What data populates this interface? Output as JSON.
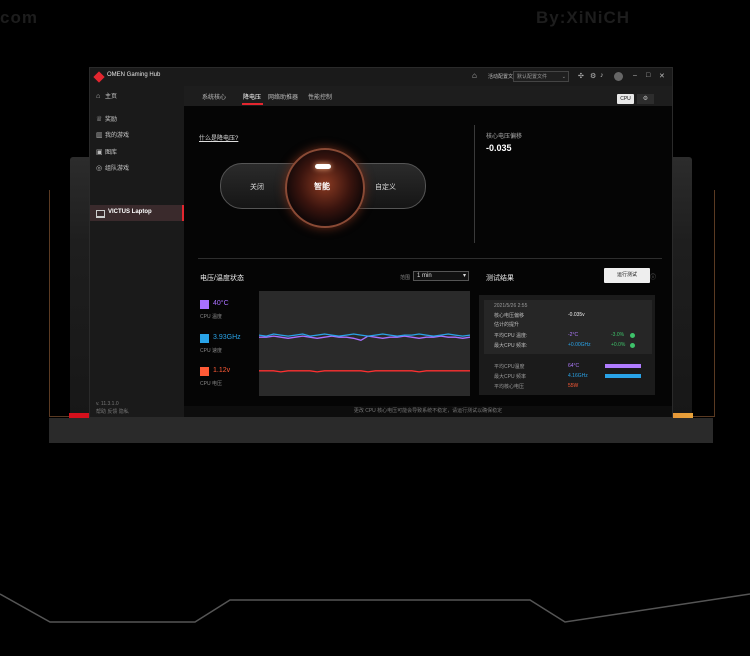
{
  "watermark": {
    "left": "com",
    "right": "By:XiNiCH"
  },
  "window": {
    "title": "OMEN Gaming Hub",
    "profile_label": "活动配置文件",
    "profile_value": "默认配置文件"
  },
  "sidebar": {
    "items": [
      {
        "icon": "home-icon",
        "glyph": "⌂",
        "label": "主页"
      },
      {
        "icon": "trophy-icon",
        "glyph": "♕",
        "label": "奖励"
      },
      {
        "icon": "library-icon",
        "glyph": "▥",
        "label": "我的游戏"
      },
      {
        "icon": "gallery-icon",
        "glyph": "▣",
        "label": "图库"
      },
      {
        "icon": "gamepad-icon",
        "glyph": "◎",
        "label": "组队游戏"
      }
    ],
    "device": "VICTUS Laptop",
    "version": "v. 11.3.1.0",
    "footer": "帮助  反馈  隐私"
  },
  "tabs": [
    {
      "label": "系统核心",
      "active": false
    },
    {
      "label": "降电压",
      "active": true
    },
    {
      "label": "网络助推器",
      "active": false
    },
    {
      "label": "性能控制",
      "active": false
    }
  ],
  "toggle": {
    "cpu": "CPU",
    "settings_glyph": "⚙"
  },
  "undervolt": {
    "what_link": "什么是降电压?",
    "mode_off": "关闭",
    "mode_smart": "智能",
    "mode_custom": "自定义",
    "offset_label": "核心电压偏移",
    "offset_value": "-0.035"
  },
  "voltage_panel": {
    "title": "电压/温度状态",
    "range_label": "范围",
    "range_value": "1 min",
    "stats": [
      {
        "value": "40°C",
        "label": "CPU 温度",
        "color": "#a970ff"
      },
      {
        "value": "3.93GHz",
        "label": "CPU 速度",
        "color": "#29a3e8"
      },
      {
        "value": "1.12v",
        "label": "CPU 电压",
        "color": "#ff5a36"
      }
    ]
  },
  "chart_data": {
    "type": "line",
    "title": "",
    "series": [
      {
        "color": "#a970ff",
        "values": [
          0.44,
          0.44,
          0.43,
          0.44,
          0.45,
          0.44,
          0.43,
          0.44,
          0.45,
          0.44,
          0.43,
          0.44,
          0.44,
          0.45,
          0.47,
          0.43,
          0.44,
          0.45,
          0.44,
          0.44,
          0.43,
          0.44,
          0.45,
          0.44,
          0.44,
          0.43,
          0.44,
          0.44,
          0.45,
          0.44
        ]
      },
      {
        "color": "#29a3e8",
        "values": [
          0.42,
          0.43,
          0.41,
          0.42,
          0.43,
          0.42,
          0.41,
          0.43,
          0.42,
          0.41,
          0.42,
          0.43,
          0.42,
          0.41,
          0.42,
          0.43,
          0.42,
          0.41,
          0.42,
          0.43,
          0.42,
          0.42,
          0.41,
          0.42,
          0.43,
          0.42,
          0.41,
          0.42,
          0.43,
          0.42
        ]
      },
      {
        "color": "#ff3030",
        "values": [
          0.76,
          0.76,
          0.76,
          0.77,
          0.76,
          0.76,
          0.76,
          0.76,
          0.77,
          0.76,
          0.76,
          0.76,
          0.76,
          0.76,
          0.76,
          0.77,
          0.76,
          0.76,
          0.76,
          0.76,
          0.76,
          0.76,
          0.77,
          0.76,
          0.76,
          0.76,
          0.76,
          0.76,
          0.76,
          0.76
        ]
      }
    ]
  },
  "results": {
    "title": "测试结果",
    "run_button": "运行测试",
    "info_glyph": "ⓘ",
    "date": "2021/5/26 2:55",
    "rows": [
      {
        "label": "核心电压偏移",
        "value": "-0.035v",
        "delta": ""
      },
      {
        "label": "估计的提升",
        "value": "",
        "delta": ""
      },
      {
        "label": "平均CPU 温度:",
        "value": "-2°C",
        "delta": "-3.0%"
      },
      {
        "label": "最大CPU 频率:",
        "value": "+0.00GHz",
        "delta": "+0.0%"
      }
    ],
    "bars": [
      {
        "label": "平均CPU温度",
        "value": "64°C",
        "color": "#b07cff",
        "fill": 0.95
      },
      {
        "label": "最大CPU 频率",
        "value": "4.16GHz",
        "color": "#29a3e8",
        "fill": 0.95
      },
      {
        "label": "平均核心电压",
        "value": "55W",
        "color": "#ff5a36",
        "fill": 0
      }
    ]
  },
  "notice": "更改 CPU 核心电压可能会导致系统不稳定，请运行测试以确保稳定"
}
